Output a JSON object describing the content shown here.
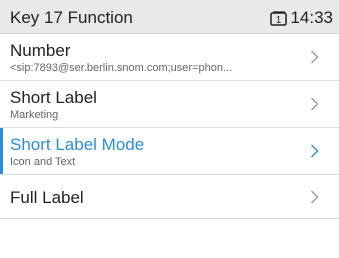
{
  "header": {
    "title": "Key 17 Function",
    "line_badge": "1",
    "time": "14:33"
  },
  "items": [
    {
      "title": "Number",
      "subtitle": "<sip:7893@ser.berlin.snom.com;user=phon...",
      "selected": false
    },
    {
      "title": "Short Label",
      "subtitle": "Marketing",
      "selected": false
    },
    {
      "title": "Short Label Mode",
      "subtitle": "Icon and Text",
      "selected": true
    },
    {
      "title": "Full Label",
      "subtitle": "",
      "selected": false
    }
  ],
  "icons": {
    "line": "phone-line-icon",
    "chevron": "chevron-right-icon"
  },
  "colors": {
    "accent": "#2b8fd6",
    "header_bg": "#e9e9e9",
    "chevron": "#9a9a9a"
  }
}
